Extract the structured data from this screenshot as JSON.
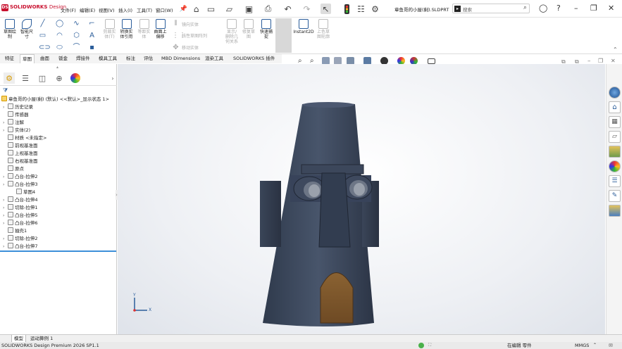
{
  "app": {
    "logo_text": "SOLIDWORKS",
    "logo_sub": "Design",
    "filename": "章鱼哥的小屋(剩).SLDPRT"
  },
  "menu": [
    "文件(F)",
    "编辑(E)",
    "视图(V)",
    "插入(I)",
    "工具(T)",
    "窗口(W)"
  ],
  "search": {
    "placeholder": "搜索"
  },
  "ribbon": {
    "sketch_buttons": [
      {
        "label": "草图绘\n制"
      },
      {
        "label": "智能尺\n寸"
      }
    ],
    "feature_buttons": [
      {
        "label": "剪裁实\n体(T)",
        "enabled": false
      },
      {
        "label": "转换实\n体引用",
        "enabled": true
      },
      {
        "label": "等距实\n体",
        "enabled": false
      },
      {
        "label": "曲面上\n偏移",
        "enabled": true
      }
    ],
    "small_items": [
      "镜向实体",
      "线性草图阵列",
      "移动实体"
    ],
    "right_buttons": [
      {
        "label": "显示/\n删除几\n何关系",
        "enabled": false
      },
      {
        "label": "修复草\n图",
        "enabled": false
      },
      {
        "label": "快速捕\n捉",
        "enabled": true
      },
      {
        "label": "快速草\n图",
        "enabled": true
      },
      {
        "label": "Instant2D",
        "enabled": true
      },
      {
        "label": "上色草\n图轮廓",
        "enabled": false
      }
    ]
  },
  "tabs": [
    "特征",
    "草图",
    "曲面",
    "钣金",
    "焊接件",
    "模具工具",
    "标注",
    "评估",
    "MBD Dimensions",
    "渲染工具",
    "SOLIDWORKS 插件"
  ],
  "active_tab": "草图",
  "tree": {
    "root": "章鱼哥的小屋(剩) (默认) <<默认>_显示状态 1>",
    "items": [
      {
        "label": "历史记录",
        "expand": true,
        "indent": 0
      },
      {
        "label": "传感器",
        "expand": false,
        "indent": 0
      },
      {
        "label": "注解",
        "expand": true,
        "indent": 0
      },
      {
        "label": "实体(2)",
        "expand": true,
        "indent": 0
      },
      {
        "label": "材质 <未指定>",
        "expand": false,
        "indent": 0
      },
      {
        "label": "前视基准面",
        "expand": false,
        "indent": 0
      },
      {
        "label": "上视基准面",
        "expand": false,
        "indent": 0
      },
      {
        "label": "右视基准面",
        "expand": false,
        "indent": 0
      },
      {
        "label": "原点",
        "expand": false,
        "indent": 0
      },
      {
        "label": "凸台-拉伸2",
        "expand": true,
        "indent": 0
      },
      {
        "label": "凸台-拉伸3",
        "expand": true,
        "indent": 0
      },
      {
        "label": "草图4",
        "expand": false,
        "indent": 1
      },
      {
        "label": "凸台-拉伸4",
        "expand": true,
        "indent": 0
      },
      {
        "label": "切除-拉伸1",
        "expand": true,
        "indent": 0
      },
      {
        "label": "凸台-拉伸5",
        "expand": true,
        "indent": 0
      },
      {
        "label": "凸台-拉伸6",
        "expand": true,
        "indent": 0
      },
      {
        "label": "抽壳1",
        "expand": false,
        "indent": 0
      },
      {
        "label": "切除-拉伸2",
        "expand": true,
        "indent": 0
      },
      {
        "label": "凸台-拉伸7",
        "expand": true,
        "indent": 0
      }
    ]
  },
  "bottom_tabs": [
    "模型",
    "运动算例 1"
  ],
  "status": {
    "product": "SOLIDWORKS Design Premium 2026 SP1.1",
    "mode": "在编辑 零件",
    "units": "MMGS"
  },
  "axis": {
    "y": "Y",
    "x": "X"
  },
  "colors": {
    "brand": "#c8102e",
    "accent": "#3d8fd9",
    "stone": "#3b4659",
    "door": "#7a5530"
  }
}
